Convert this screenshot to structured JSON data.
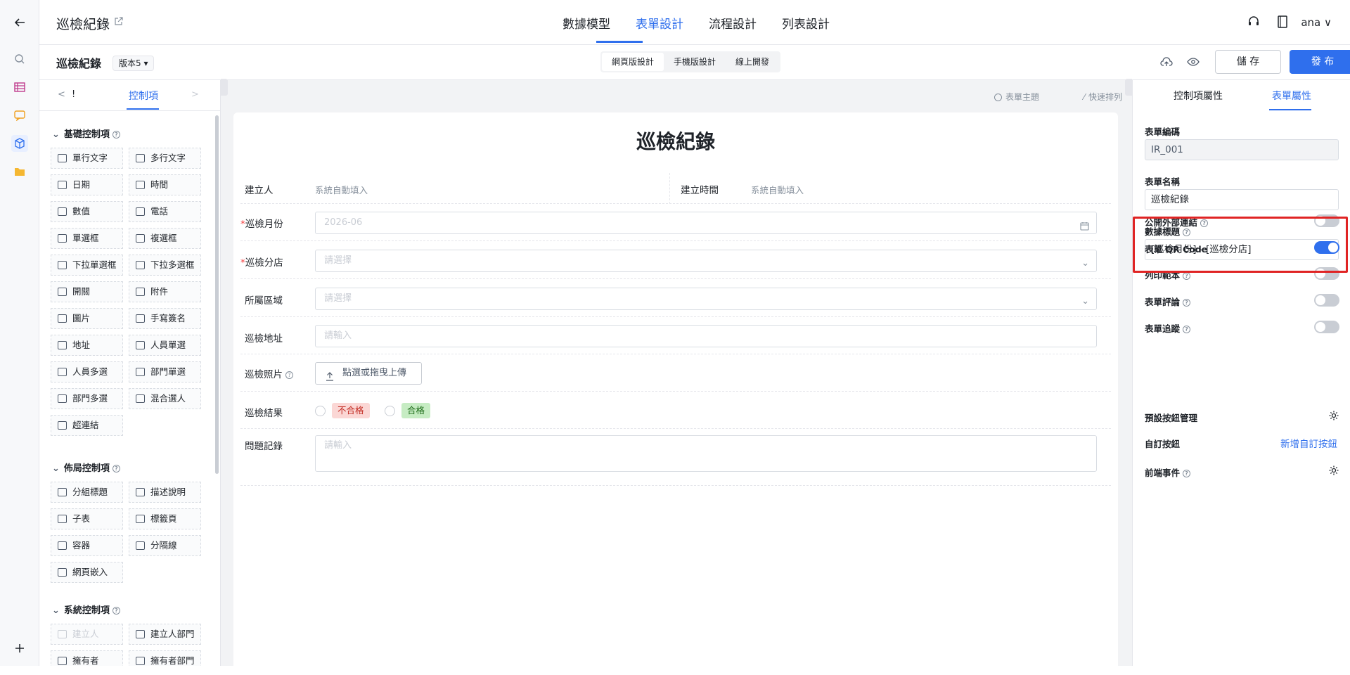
{
  "topbar": {
    "app_title": "巡檢紀錄",
    "tabs": [
      "數據模型",
      "表單設計",
      "流程設計",
      "列表設計"
    ],
    "active_tab": "表單設計",
    "user": "ana ∨"
  },
  "subbar": {
    "form_title": "巡檢紀錄",
    "version": "版本5 ▾",
    "design_modes": [
      "網頁版設計",
      "手機版設計",
      "線上開發"
    ],
    "save_label": "儲 存",
    "publish_label": "發 布"
  },
  "left_panel": {
    "tab_label": "控制項",
    "prev_label": "<",
    "prev_tab": "!",
    "next_label": ">",
    "sections": [
      {
        "title": "基礎控制項",
        "items": [
          "單行文字",
          "多行文字",
          "日期",
          "時間",
          "數值",
          "電話",
          "單選框",
          "複選框",
          "下拉單選框",
          "下拉多選框",
          "開關",
          "附件",
          "圖片",
          "手寫簽名",
          "地址",
          "人員單選",
          "人員多選",
          "部門單選",
          "部門多選",
          "混合選人",
          "超連結"
        ]
      },
      {
        "title": "佈局控制項",
        "items": [
          "分組標題",
          "描述說明",
          "子表",
          "標籤頁",
          "容器",
          "分隔線",
          "網頁嵌入"
        ]
      },
      {
        "title": "系統控制項",
        "items": [
          "建立人",
          "建立人部門",
          "擁有者",
          "擁有者部門"
        ]
      }
    ]
  },
  "canvas": {
    "tools": [
      "表單主題",
      "快速排列"
    ],
    "form_title": "巡檢紀錄",
    "fields": {
      "creator_label": "建立人",
      "creator_value": "系統自動填入",
      "created_time_label": "建立時間",
      "created_time_value": "系統自動填入",
      "month_label": "巡檢月份",
      "month_value": "2026-06",
      "branch_label": "巡檢分店",
      "branch_placeholder": "請選擇",
      "region_label": "所屬區域",
      "region_placeholder": "請選擇",
      "address_label": "巡檢地址",
      "address_placeholder": "請輸入",
      "photo_label": "巡檢照片",
      "upload_label": "點選或拖曳上傳",
      "result_label": "巡檢結果",
      "result_options": [
        "不合格",
        "合格"
      ],
      "issue_label": "問題記錄",
      "issue_placeholder": "請輸入"
    }
  },
  "right_panel": {
    "tabs": [
      "控制項屬性",
      "表單屬性"
    ],
    "active_tab": "表單屬性",
    "form_code_label": "表單編碼",
    "form_code_value": "IR_001",
    "form_name_label": "表單名稱",
    "form_name_value": "巡檢紀錄",
    "data_title_label": "數據標題",
    "data_title_value": "[巡檢月份] - [巡檢分店]",
    "data_title_more": "···",
    "toggles": [
      {
        "label": "公開外部連結",
        "on": false
      },
      {
        "label": "表單 QR Code",
        "on": true
      },
      {
        "label": "列印範本",
        "on": false
      },
      {
        "label": "表單評論",
        "on": false
      },
      {
        "label": "表單追蹤",
        "on": false
      }
    ],
    "preset_buttons_label": "預設按鈕管理",
    "custom_buttons_label": "自訂按鈕",
    "add_custom_button": "新增自訂按鈕",
    "frontend_events_label": "前端事件"
  }
}
